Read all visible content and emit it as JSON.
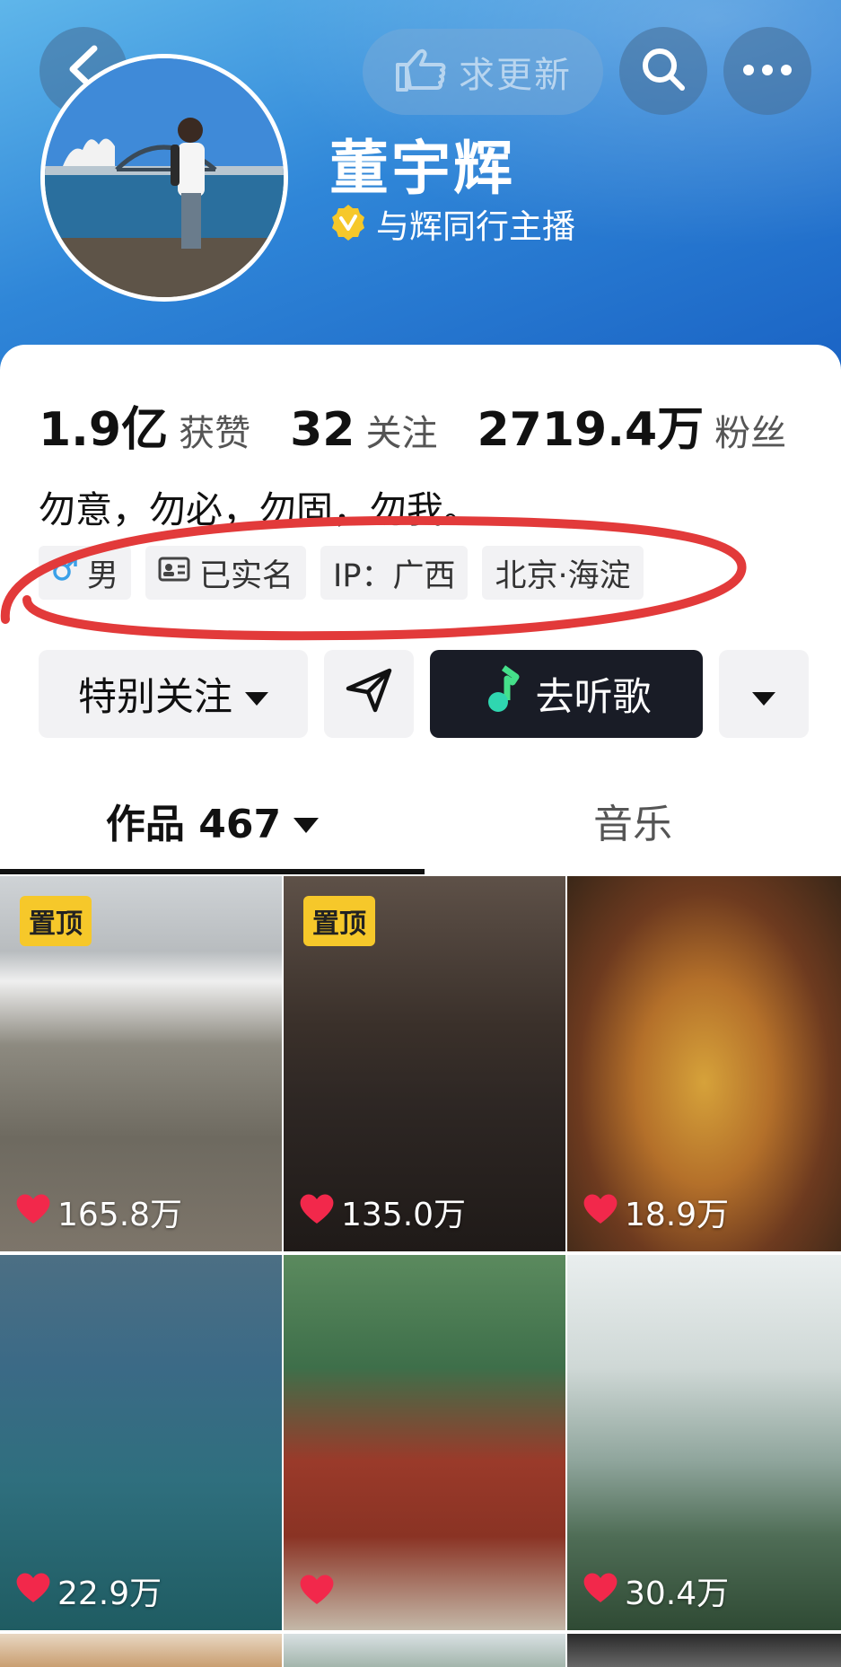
{
  "header": {
    "update_button_label": "求更新",
    "user_name": "董宇辉",
    "verify_label": "与辉同行主播",
    "icons": [
      "back-icon",
      "hand-point-icon",
      "search-icon",
      "more-icon",
      "verified-v-icon"
    ]
  },
  "stats": [
    {
      "value": "1.9亿",
      "label": "获赞"
    },
    {
      "value": "32",
      "label": "关注"
    },
    {
      "value": "2719.4万",
      "label": "粉丝"
    }
  ],
  "bio": "勿意，勿必，勿固，勿我。",
  "tags": {
    "gender": "男",
    "verified": "已实名",
    "ip": "IP：广西",
    "location": "北京·海淀"
  },
  "actions": {
    "follow_label": "特别关注",
    "listen_label": "去听歌"
  },
  "tabs": {
    "works_label": "作品 467",
    "music_label": "音乐"
  },
  "videos": [
    {
      "pinned": "置顶",
      "likes": "165.8万"
    },
    {
      "pinned": "置顶",
      "likes": "135.0万"
    },
    {
      "pinned": "",
      "likes": "18.9万"
    },
    {
      "pinned": "",
      "likes": "22.9万"
    },
    {
      "pinned": "",
      "likes": ""
    },
    {
      "pinned": "",
      "likes": "30.4万"
    }
  ],
  "colors": {
    "header_blue": "#2f86d8",
    "dark_button": "#191c26",
    "pin_yellow": "#f6c82a",
    "heart_red": "#f2284b",
    "annotation_red": "#e23a3a"
  }
}
